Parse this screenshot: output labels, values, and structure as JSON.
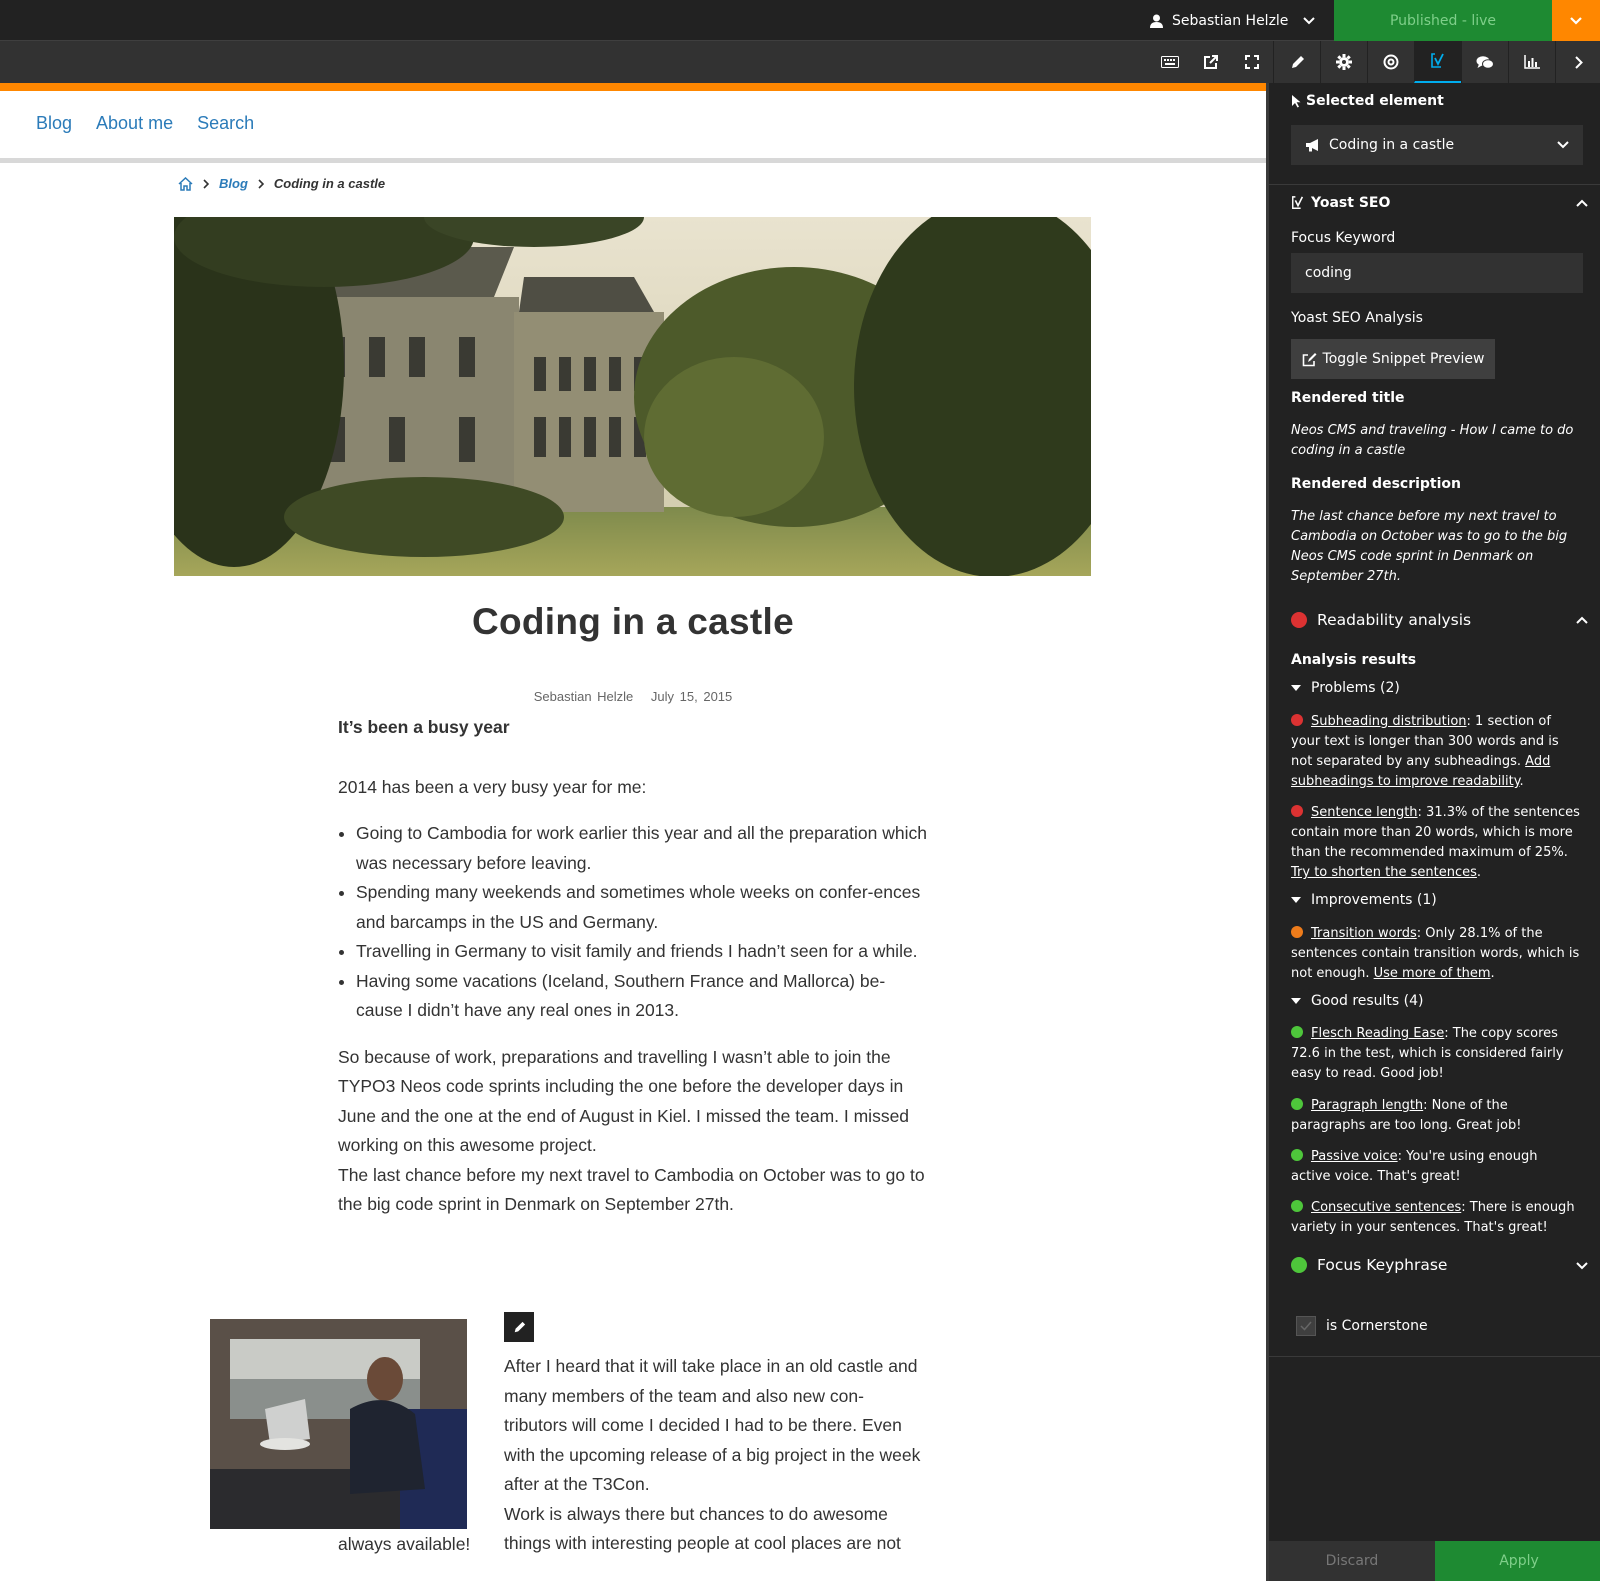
{
  "topbar": {
    "user_name": "Sebastian Helzle",
    "publish_label": "Published - live"
  },
  "site": {
    "nav": [
      "Blog",
      "About me",
      "Search"
    ]
  },
  "breadcrumb": {
    "parent": "Blog",
    "current": "Coding in a castle"
  },
  "article": {
    "title": "Coding in a castle",
    "author": "Sebastian Helzle",
    "date": "July 15, 2015",
    "subheading": "It’s been a busy year",
    "intro": "2014 has been a very busy year for me:",
    "bullets": [
      "Going to Cambodia for work earlier this year and all the preparation which was necessary before leaving.",
      "Spending many weekends and sometimes whole weeks on confer-ences and barcamps in the US and Germany.",
      "Travelling in Germany to visit family and friends I hadn’t seen for a while.",
      "Having some vacations (Iceland, Southern France and Mallorca) be-cause I didn’t have any real ones in 2013."
    ],
    "para1": "So because of work, preparations and travelling I wasn’t able to join the TYPO3 Neos code sprints including the one before the developer days in June and the one at the end of August in Kiel. I missed the team. I missed working on this awesome project.",
    "para2": "The last chance before my next travel to Cambodia on October was to go to the big code sprint in Denmark on September 27th.",
    "float_para1": "After I heard that it will take place in an old castle and many members of the team and also new con-tributors will come I decided I had to be there. Even with the upcoming release of a big project in the week after at the T3Con.",
    "float_para2": "Work is always there but chances to do awesome things with interesting people at cool places are not",
    "float_tail": "always available!"
  },
  "inspector": {
    "selected_label": "Selected element",
    "selected_value": "Coding in a castle",
    "yoast_title": "Yoast SEO",
    "focus_keyword_label": "Focus Keyword",
    "focus_keyword_value": "coding",
    "analysis_label": "Yoast SEO Analysis",
    "snippet_button": "Toggle Snippet Preview",
    "rendered_title_label": "Rendered title",
    "rendered_title": "Neos CMS and traveling - How I came to do coding in a castle",
    "rendered_desc_label": "Rendered description",
    "rendered_desc": "The last chance before my next travel to Cambodia on October was to go to the big Neos CMS code sprint in Denmark on September 27th.",
    "readability_title": "Readability analysis",
    "analysis_results": "Analysis results",
    "problems_label": "Problems (2)",
    "improvements_label": "Improvements (1)",
    "good_label": "Good results (4)",
    "results": {
      "subheading": {
        "link": "Subheading distribution",
        "text": ": 1 section of your text is longer than 300 words and is not separated by any subheadings. ",
        "fix": "Add subheadings to improve readability",
        "end": "."
      },
      "sentence": {
        "link": "Sentence length",
        "text": ": 31.3% of the sentences contain more than 20 words, which is more than the recommended maximum of 25%. ",
        "fix": "Try to shorten the sentences",
        "end": "."
      },
      "transition": {
        "link": "Transition words",
        "text": ": Only 28.1% of the sentences contain transition words, which is not enough. ",
        "fix": "Use more of them",
        "end": "."
      },
      "flesch": {
        "link": "Flesch Reading Ease",
        "text": ": The copy scores 72.6 in the test, which is considered fairly easy to read. Good job!"
      },
      "paragraph": {
        "link": "Paragraph length",
        "text": ": None of the paragraphs are too long. Great job!"
      },
      "passive": {
        "link": "Passive voice",
        "text": ": You're using enough active voice. That's great!"
      },
      "consecutive": {
        "link": "Consecutive sentences",
        "text": ": There is enough variety in your sentences. That's great!"
      }
    },
    "focus_keyphrase": "Focus Keyphrase",
    "cornerstone_label": "is Cornerstone",
    "discard": "Discard",
    "apply": "Apply"
  },
  "colors": {
    "accent_orange": "#ff8700",
    "publish_green": "#1e8a32",
    "link_blue": "#2b7bb9",
    "problem_red": "#dc3232",
    "improve_orange": "#ee7c1b",
    "good_green": "#4ec63b"
  },
  "icons": [
    "user-icon",
    "chevron-down-icon",
    "keyboard-icon",
    "external-link-icon",
    "fullscreen-icon",
    "pencil-icon",
    "gear-icon",
    "target-icon",
    "yoast-icon",
    "comments-icon",
    "chart-icon",
    "chevron-right-icon",
    "home-icon",
    "cursor-icon",
    "megaphone-icon",
    "chevron-up-icon",
    "edit-icon",
    "sad-face-icon",
    "smile-face-icon",
    "caret-down-icon",
    "check-icon"
  ]
}
